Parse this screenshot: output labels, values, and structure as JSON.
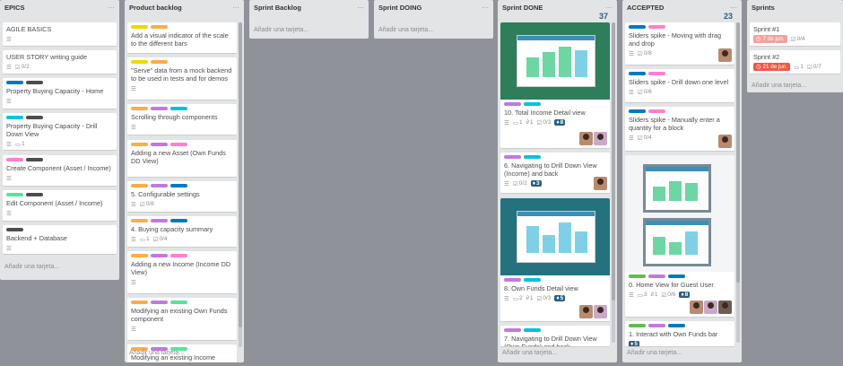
{
  "labels_colors": {
    "green": "#61bd4f",
    "yellow": "#f2d600",
    "orange": "#ffab4a",
    "red": "#eb5a46",
    "purple": "#c377e0",
    "blue": "#0079bf",
    "sky": "#00c2e0",
    "lime": "#51e898",
    "pink": "#ff80ce",
    "black": "#4d4d4d"
  },
  "add_card_label": "Añadir una tarjeta...",
  "lists": {
    "epics": {
      "title": "EPICS",
      "cards": [
        {
          "title": "AGILE BASICS"
        },
        {
          "title": "USER STORY writing guide",
          "checklist": "0/2"
        },
        {
          "title": "Property Buying Capacity - Home"
        },
        {
          "title": "Property Buying Capacity - Drill Down View",
          "comments": "1"
        },
        {
          "title": "Create Component (Asset / Income)"
        },
        {
          "title": "Edit Component (Asset / Income)"
        },
        {
          "title": "Backend + Database"
        }
      ]
    },
    "backlog": {
      "title": "Product backlog",
      "cards": [
        {
          "title": "Add a visual indicator of the scale to the different bars"
        },
        {
          "title": "\"Serve\" data from a mock backend to be used in tests and for demos"
        },
        {
          "title": "Scrolling through components"
        },
        {
          "title": "Adding a new Asset (Own Funds DD View)"
        },
        {
          "title": "5. Configurable settings",
          "checklist": "0/8"
        },
        {
          "title": "4. Buying capacity summary",
          "comments": "1",
          "checklist": "0/4"
        },
        {
          "title": "Adding a new Income (Income DD View)"
        },
        {
          "title": "Modifying an existing Own Funds component"
        },
        {
          "title": "Modifying an existing Income component"
        }
      ]
    },
    "sprint_backlog": {
      "title": "Sprint Backlog"
    },
    "sprint_doing": {
      "title": "Sprint DOING"
    },
    "sprint_done": {
      "title": "Sprint DONE",
      "count": "37",
      "cards": [
        {
          "title": "10. Total Income Detail view",
          "comments": "1",
          "attachments": "1",
          "checklist": "0/3",
          "votes": "8"
        },
        {
          "title": "6. Navigating to Drill Down View (Income) and back",
          "checklist": "0/2",
          "votes": "3"
        },
        {
          "title": "8. Own Funds Detail view",
          "comments": "2",
          "attachments": "1",
          "checklist": "0/3",
          "votes": "5"
        },
        {
          "title": "7. Navigating to Drill Down View (Own Funds) and back"
        }
      ]
    },
    "accepted": {
      "title": "ACCEPTED",
      "count": "23",
      "cards": [
        {
          "title": "Sliders spike - Moving with drag and drop",
          "checklist": "0/8"
        },
        {
          "title": "Sliders spike - Drill down one level",
          "checklist": "0/6"
        },
        {
          "title": "Sliders spike - Manually enter a quantity for a block",
          "checklist": "0/4"
        },
        {
          "title": "0. Home View for Guest User",
          "comments": "3",
          "attachments": "1",
          "checklist": "0/6",
          "votes": "8"
        },
        {
          "title": "1. Interact with Own Funds bar",
          "votes": "5"
        }
      ]
    },
    "sprints": {
      "title": "Sprints",
      "cards": [
        {
          "title": "Sprint #1",
          "due": "7 de jun.",
          "checklist": "0/4"
        },
        {
          "title": "Sprint #2",
          "due": "21 de jun.",
          "comments": "1",
          "checklist": "0/7"
        }
      ]
    }
  },
  "icons": {
    "description": "hamburger-icon",
    "checklist": "checklist-icon",
    "comment": "comment-icon",
    "attachment": "paperclip-icon",
    "vote": "vote-icon",
    "clock": "clock-icon",
    "menu": "ellipsis-icon"
  }
}
